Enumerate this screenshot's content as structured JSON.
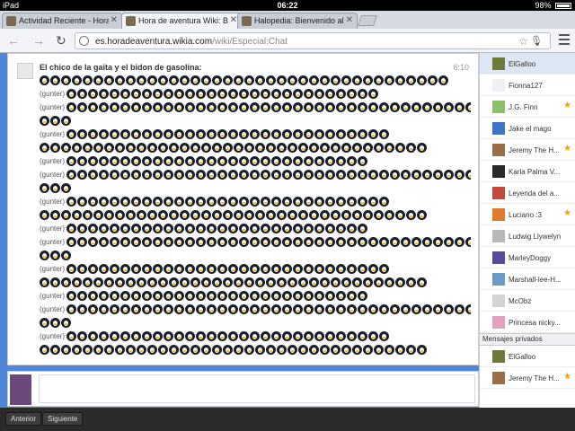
{
  "status": {
    "device": "iPad",
    "time": "06:22",
    "battery": "98%"
  },
  "tabs": [
    {
      "label": "Actividad Reciente - Hora d",
      "active": false
    },
    {
      "label": "Hora de aventura Wiki: Bie",
      "active": true
    },
    {
      "label": "Halopedia: Bienvenido al c",
      "active": false
    }
  ],
  "address": {
    "domain": "es.horadeaventura.wikia.com",
    "path": "/wiki/Especial:Chat"
  },
  "message": {
    "author": "El chico de la gaita y el bidon de gasolina:",
    "time": "6:10",
    "emote_label": "(gunter)"
  },
  "emote_rows": [
    {
      "label": false,
      "count": 38
    },
    {
      "label": true,
      "count": 29
    },
    {
      "label": true,
      "count": 39
    },
    {
      "label": false,
      "count": 3
    },
    {
      "label": true,
      "count": 30
    },
    {
      "label": false,
      "count": 36
    },
    {
      "label": true,
      "count": 28
    },
    {
      "label": true,
      "count": 39
    },
    {
      "label": false,
      "count": 3
    },
    {
      "label": true,
      "count": 30
    },
    {
      "label": false,
      "count": 36
    },
    {
      "label": true,
      "count": 28
    },
    {
      "label": true,
      "count": 39
    },
    {
      "label": false,
      "count": 3
    },
    {
      "label": true,
      "count": 30
    },
    {
      "label": false,
      "count": 36
    },
    {
      "label": true,
      "count": 28
    },
    {
      "label": true,
      "count": 39
    },
    {
      "label": false,
      "count": 3
    },
    {
      "label": true,
      "count": 30
    },
    {
      "label": false,
      "count": 36
    }
  ],
  "users": [
    {
      "name": "ElGalloo",
      "star": false,
      "selected": true,
      "color": "#6c7a3c"
    },
    {
      "name": "Fionna127",
      "star": false,
      "selected": false,
      "color": "#eef0f3"
    },
    {
      "name": "J.G. Finn",
      "star": true,
      "selected": false,
      "color": "#8bbf6a"
    },
    {
      "name": "Jake el mago",
      "star": false,
      "selected": false,
      "color": "#3d76c9"
    },
    {
      "name": "Jeremy The H...",
      "star": true,
      "selected": false,
      "color": "#9b6d46"
    },
    {
      "name": "Karla Palma V...",
      "star": false,
      "selected": false,
      "color": "#2a2a2a"
    },
    {
      "name": "Leyenda del a...",
      "star": false,
      "selected": false,
      "color": "#c14b3a"
    },
    {
      "name": "Luciano :3",
      "star": true,
      "selected": false,
      "color": "#e07a2f"
    },
    {
      "name": "Ludwig Llywelyn",
      "star": false,
      "selected": false,
      "color": "#b8b8b8"
    },
    {
      "name": "MarleyDoggy",
      "star": false,
      "selected": false,
      "color": "#5a4a9a"
    },
    {
      "name": "Marshall-lee-H...",
      "star": false,
      "selected": false,
      "color": "#6a9ac8"
    },
    {
      "name": "McObz",
      "star": false,
      "selected": false,
      "color": "#d3d3d3"
    },
    {
      "name": "Princesa nicky...",
      "star": false,
      "selected": false,
      "color": "#e4a0c0"
    }
  ],
  "private_header": "Mensajes privados",
  "private_users": [
    {
      "name": "ElGalloo",
      "star": false,
      "selected": false,
      "color": "#6c7a3c"
    },
    {
      "name": "Jeremy The H...",
      "star": true,
      "selected": false,
      "color": "#9b6d46"
    }
  ],
  "star_glyph": "★",
  "bottom": {
    "prev": "Anterior",
    "next": "Siguiente"
  }
}
